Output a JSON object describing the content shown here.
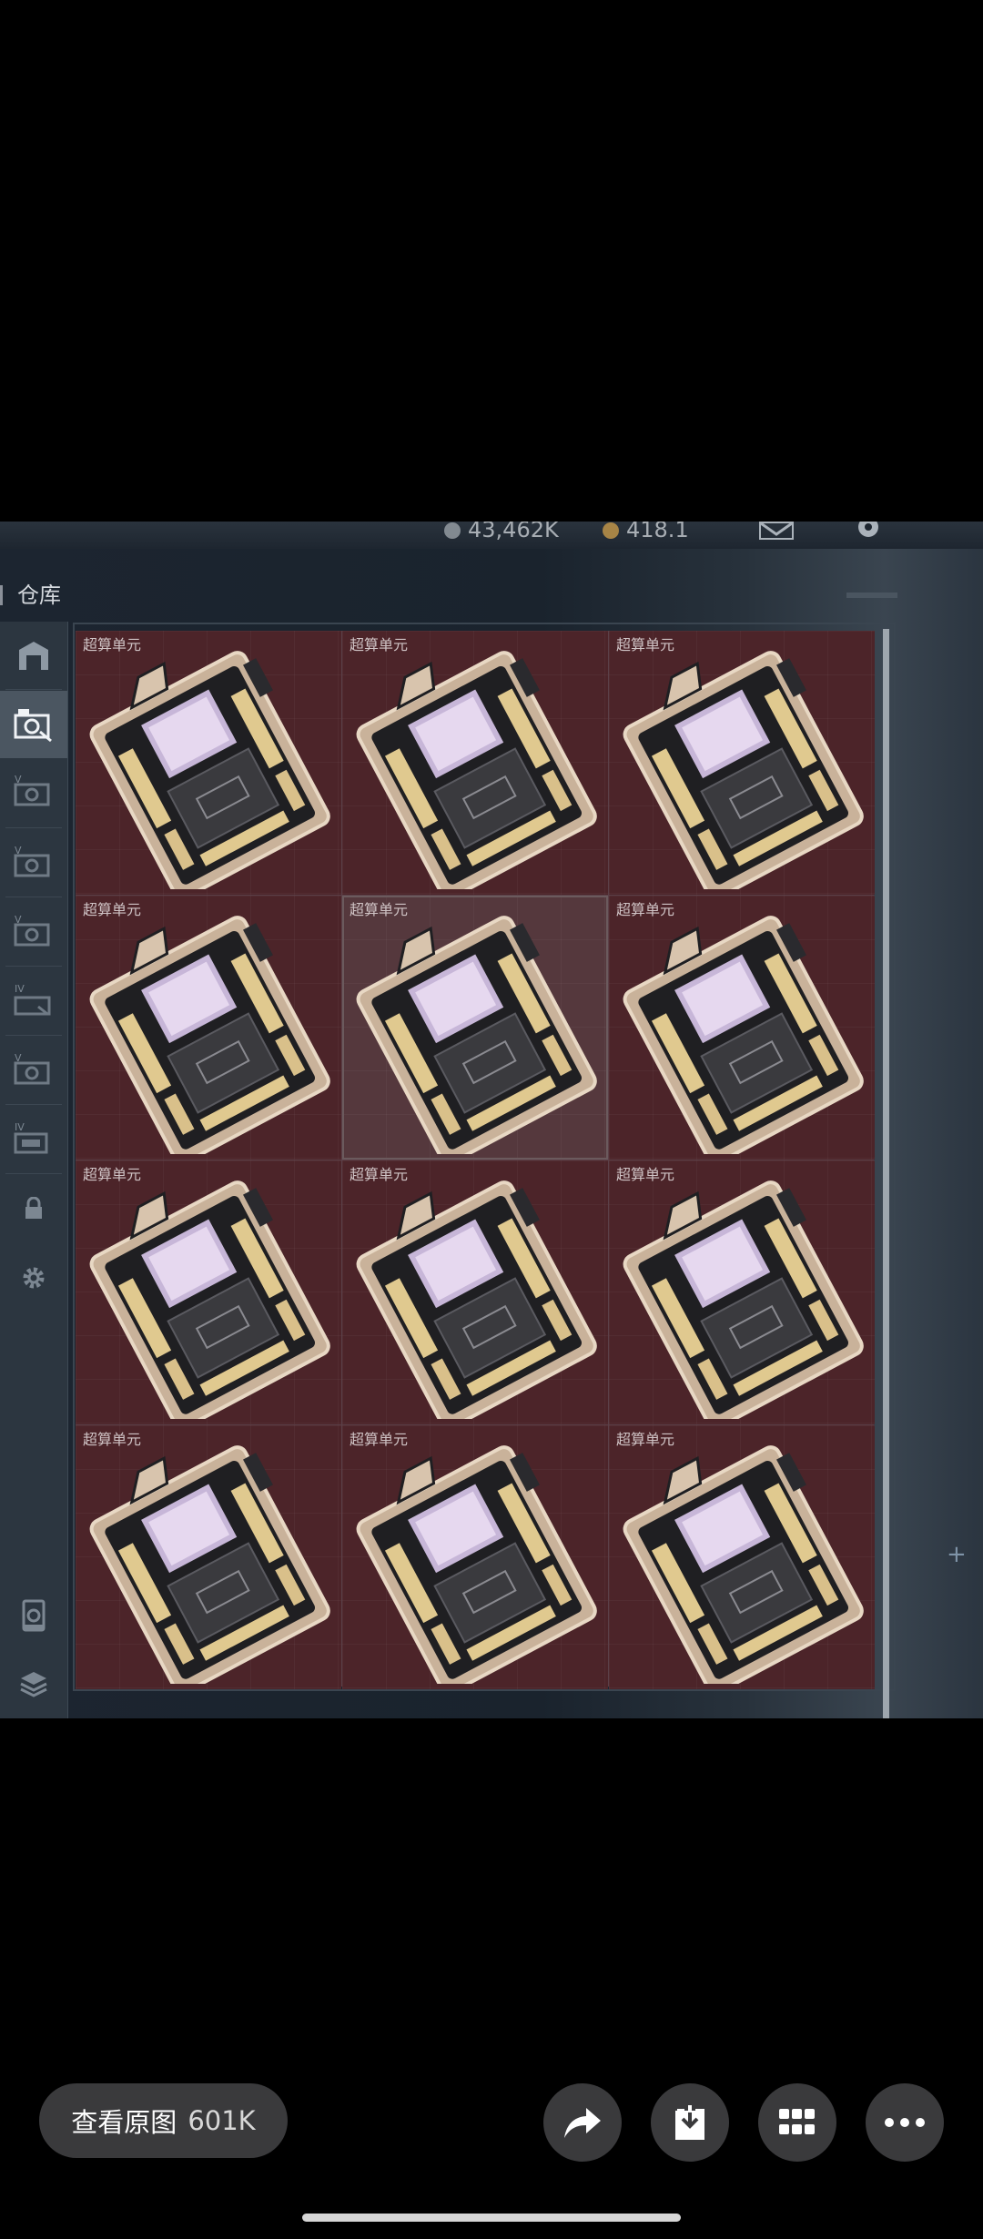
{
  "game": {
    "currency_1": "43,462K",
    "currency_2": "418.1",
    "panel_title": "仓库",
    "sidebar_icons": [
      "warehouse-icon",
      "gear-case-icon-I",
      "gear-case-icon-V",
      "gear-case-icon-V",
      "gear-case-icon-V",
      "gear-case-icon-IV",
      "gear-case-icon-V",
      "gear-case-icon-IV",
      "lock-icon",
      "settings-icon",
      "recycle-icon",
      "layers-icon"
    ],
    "sidebar_tier_labels": [
      "",
      "V",
      "V",
      "V",
      "IV",
      "V",
      "IV"
    ],
    "items": [
      {
        "label": "超算单元"
      },
      {
        "label": "超算单元"
      },
      {
        "label": "超算单元"
      },
      {
        "label": "超算单元"
      },
      {
        "label": "超算单元"
      },
      {
        "label": "超算单元"
      },
      {
        "label": "超算单元"
      },
      {
        "label": "超算单元"
      },
      {
        "label": "超算单元"
      },
      {
        "label": "超算单元"
      },
      {
        "label": "超算单元"
      },
      {
        "label": "超算单元"
      }
    ]
  },
  "viewer": {
    "view_original_label": "查看原图",
    "view_original_size": "601K",
    "buttons": [
      "share-icon",
      "download-icon",
      "apps-grid-icon",
      "more-icon"
    ]
  },
  "colors": {
    "cell_background": "#4c2429",
    "sidebar_background": "#2c3640",
    "viewer_button": "#3a3a3c"
  }
}
